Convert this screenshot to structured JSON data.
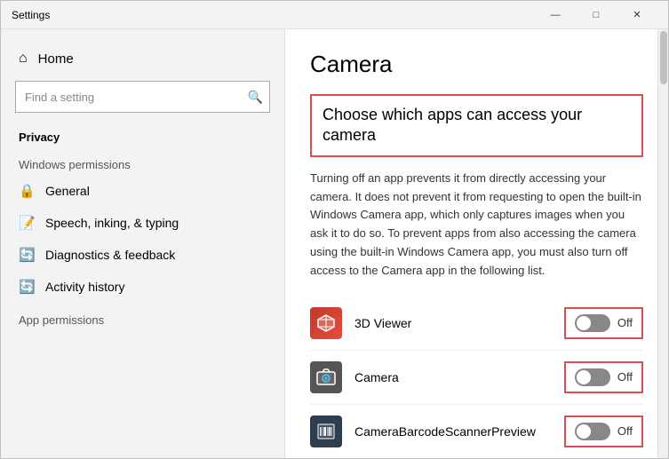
{
  "window": {
    "title": "Settings",
    "controls": {
      "minimize": "—",
      "maximize": "□",
      "close": "✕"
    }
  },
  "sidebar": {
    "home_label": "Home",
    "search_placeholder": "Find a setting",
    "privacy_section": "Privacy",
    "windows_permissions_section": "Windows permissions",
    "nav_items": [
      {
        "id": "general",
        "label": "General",
        "icon": "🔒"
      },
      {
        "id": "speech",
        "label": "Speech, inking, & typing",
        "icon": "📝"
      },
      {
        "id": "diagnostics",
        "label": "Diagnostics & feedback",
        "icon": "🔄"
      },
      {
        "id": "activity",
        "label": "Activity history",
        "icon": "🔄"
      }
    ],
    "app_permissions_section": "App permissions"
  },
  "main": {
    "page_title": "Camera",
    "highlighted_heading": "Choose which apps can access your camera",
    "description": "Turning off an app prevents it from directly accessing your camera. It does not prevent it from requesting to open the built-in Windows Camera app, which only captures images when you ask it to do so. To prevent apps from also accessing the camera using the built-in Windows Camera app, you must also turn off access to the Camera app in the following list.",
    "apps": [
      {
        "id": "3dviewer",
        "name": "3D Viewer",
        "icon_label": "3D",
        "toggle_state": "Off"
      },
      {
        "id": "camera",
        "name": "Camera",
        "icon_label": "📷",
        "toggle_state": "Off"
      },
      {
        "id": "barcode",
        "name": "CameraBarcodeScannerPreview",
        "icon_label": "📷",
        "toggle_state": "Off"
      }
    ]
  }
}
